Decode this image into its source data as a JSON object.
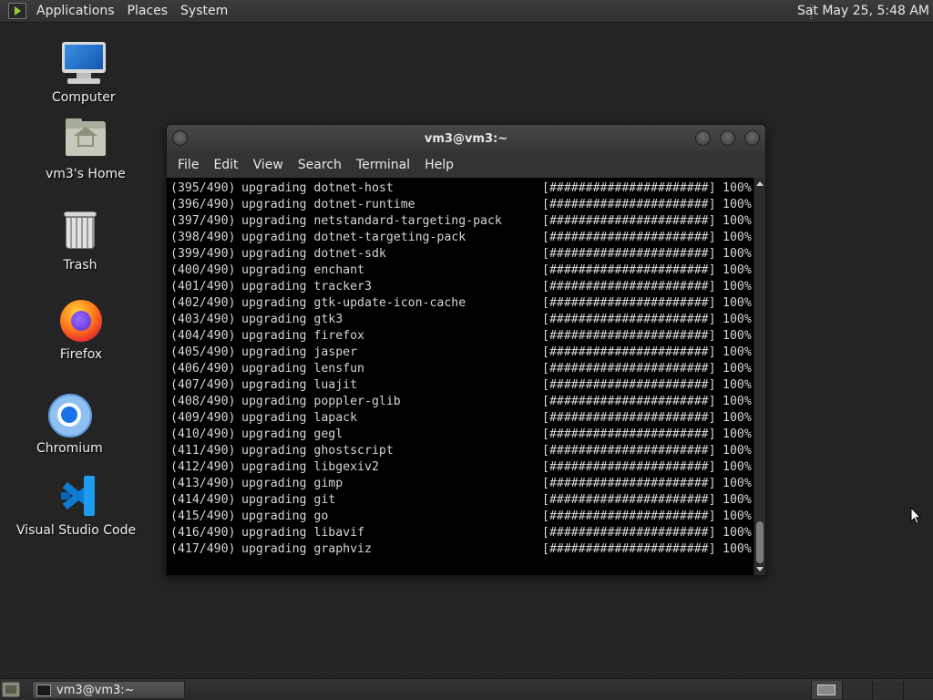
{
  "top_panel": {
    "menus": [
      "Applications",
      "Places",
      "System"
    ],
    "clock": "Sat May 25,  5:48 AM"
  },
  "desktop_icons": [
    {
      "label": "Computer",
      "icon": "computer-icon"
    },
    {
      "label": "vm3's Home",
      "icon": "home-folder-icon"
    },
    {
      "label": "Trash",
      "icon": "trash-icon"
    },
    {
      "label": "Firefox",
      "icon": "firefox-icon"
    },
    {
      "label": "Chromium",
      "icon": "chromium-icon"
    },
    {
      "label": "Visual Studio Code",
      "icon": "vscode-icon"
    }
  ],
  "window": {
    "title": "vm3@vm3:~",
    "menus": [
      "File",
      "Edit",
      "View",
      "Search",
      "Terminal",
      "Help"
    ],
    "lines": [
      {
        "idx": "(395/490)",
        "action": "upgrading",
        "pkg": "dotnet-host",
        "bar": "[######################]",
        "pct": "100%"
      },
      {
        "idx": "(396/490)",
        "action": "upgrading",
        "pkg": "dotnet-runtime",
        "bar": "[######################]",
        "pct": "100%"
      },
      {
        "idx": "(397/490)",
        "action": "upgrading",
        "pkg": "netstandard-targeting-pack",
        "bar": "[######################]",
        "pct": "100%"
      },
      {
        "idx": "(398/490)",
        "action": "upgrading",
        "pkg": "dotnet-targeting-pack",
        "bar": "[######################]",
        "pct": "100%"
      },
      {
        "idx": "(399/490)",
        "action": "upgrading",
        "pkg": "dotnet-sdk",
        "bar": "[######################]",
        "pct": "100%"
      },
      {
        "idx": "(400/490)",
        "action": "upgrading",
        "pkg": "enchant",
        "bar": "[######################]",
        "pct": "100%"
      },
      {
        "idx": "(401/490)",
        "action": "upgrading",
        "pkg": "tracker3",
        "bar": "[######################]",
        "pct": "100%"
      },
      {
        "idx": "(402/490)",
        "action": "upgrading",
        "pkg": "gtk-update-icon-cache",
        "bar": "[######################]",
        "pct": "100%"
      },
      {
        "idx": "(403/490)",
        "action": "upgrading",
        "pkg": "gtk3",
        "bar": "[######################]",
        "pct": "100%"
      },
      {
        "idx": "(404/490)",
        "action": "upgrading",
        "pkg": "firefox",
        "bar": "[######################]",
        "pct": "100%"
      },
      {
        "idx": "(405/490)",
        "action": "upgrading",
        "pkg": "jasper",
        "bar": "[######################]",
        "pct": "100%"
      },
      {
        "idx": "(406/490)",
        "action": "upgrading",
        "pkg": "lensfun",
        "bar": "[######################]",
        "pct": "100%"
      },
      {
        "idx": "(407/490)",
        "action": "upgrading",
        "pkg": "luajit",
        "bar": "[######################]",
        "pct": "100%"
      },
      {
        "idx": "(408/490)",
        "action": "upgrading",
        "pkg": "poppler-glib",
        "bar": "[######################]",
        "pct": "100%"
      },
      {
        "idx": "(409/490)",
        "action": "upgrading",
        "pkg": "lapack",
        "bar": "[######################]",
        "pct": "100%"
      },
      {
        "idx": "(410/490)",
        "action": "upgrading",
        "pkg": "gegl",
        "bar": "[######################]",
        "pct": "100%"
      },
      {
        "idx": "(411/490)",
        "action": "upgrading",
        "pkg": "ghostscript",
        "bar": "[######################]",
        "pct": "100%"
      },
      {
        "idx": "(412/490)",
        "action": "upgrading",
        "pkg": "libgexiv2",
        "bar": "[######################]",
        "pct": "100%"
      },
      {
        "idx": "(413/490)",
        "action": "upgrading",
        "pkg": "gimp",
        "bar": "[######################]",
        "pct": "100%"
      },
      {
        "idx": "(414/490)",
        "action": "upgrading",
        "pkg": "git",
        "bar": "[######################]",
        "pct": "100%"
      },
      {
        "idx": "(415/490)",
        "action": "upgrading",
        "pkg": "go",
        "bar": "[######################]",
        "pct": "100%"
      },
      {
        "idx": "(416/490)",
        "action": "upgrading",
        "pkg": "libavif",
        "bar": "[######################]",
        "pct": "100%"
      },
      {
        "idx": "(417/490)",
        "action": "upgrading",
        "pkg": "graphviz",
        "bar": "[######################]",
        "pct": "100%"
      }
    ]
  },
  "taskbar": {
    "task_label": "vm3@vm3:~"
  },
  "colors": {
    "desktop_bg": "#242424",
    "terminal_bg": "#000000",
    "terminal_fg": "#d6d6d6"
  }
}
